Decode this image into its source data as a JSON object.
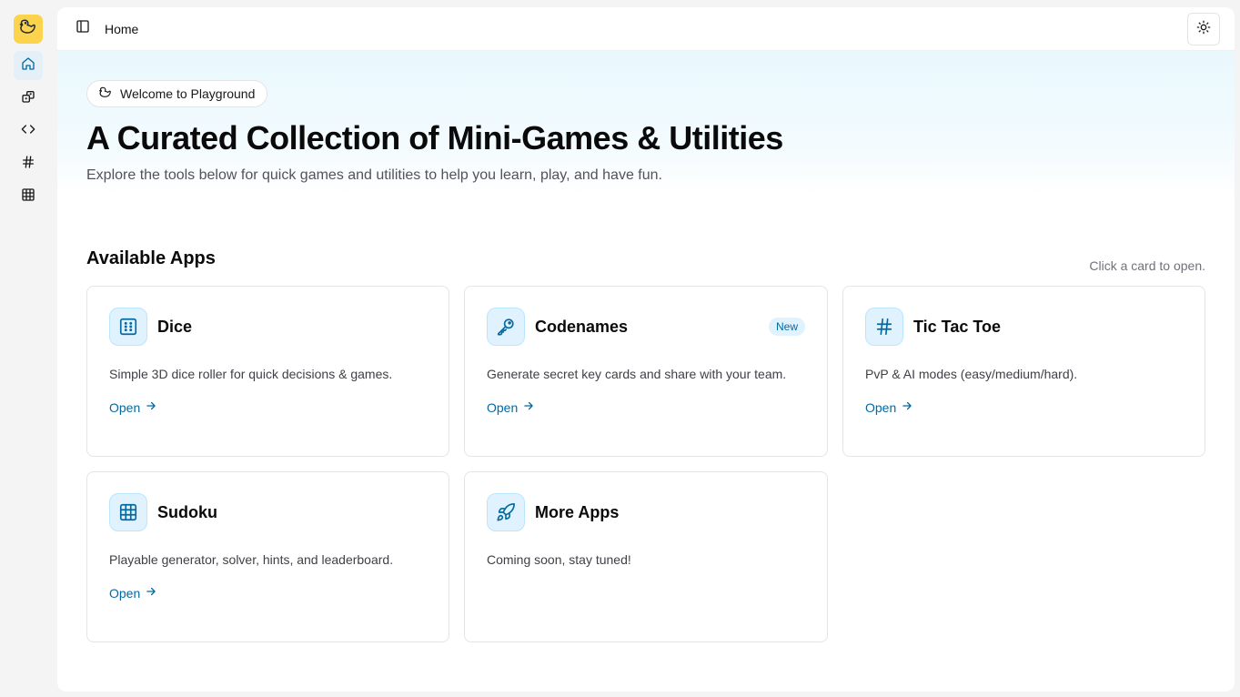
{
  "sidebar": {
    "logo_icon": "duck-icon",
    "items": [
      {
        "name": "home",
        "icon": "home-icon",
        "active": true
      },
      {
        "name": "dice",
        "icon": "dice-icon",
        "active": false
      },
      {
        "name": "code",
        "icon": "code-icon",
        "active": false
      },
      {
        "name": "hash",
        "icon": "hash-icon",
        "active": false
      },
      {
        "name": "grid",
        "icon": "grid-icon",
        "active": false
      }
    ]
  },
  "topbar": {
    "title": "Home",
    "toggle_icon": "sidebar-toggle-icon",
    "theme_icon": "sun-icon"
  },
  "hero": {
    "pill_label": "Welcome to Playground",
    "title": "A Curated Collection of Mini-Games & Utilities",
    "subtitle": "Explore the tools below for quick games and utilities to help you learn, play, and have fun."
  },
  "apps_section": {
    "title": "Available Apps",
    "hint": "Click a card to open.",
    "cards": [
      {
        "title": "Dice",
        "icon": "dice-icon",
        "description": "Simple 3D dice roller for quick decisions & games.",
        "link": "Open",
        "badge": ""
      },
      {
        "title": "Codenames",
        "icon": "key-icon",
        "description": "Generate secret key cards and share with your team.",
        "link": "Open",
        "badge": "New"
      },
      {
        "title": "Tic Tac Toe",
        "icon": "hash-icon",
        "description": "PvP & AI modes (easy/medium/hard).",
        "link": "Open",
        "badge": ""
      },
      {
        "title": "Sudoku",
        "icon": "grid-icon",
        "description": "Playable generator, solver, hints, and leaderboard.",
        "link": "Open",
        "badge": ""
      },
      {
        "title": "More Apps",
        "icon": "rocket-icon",
        "description": "Coming soon, stay tuned!",
        "link": "",
        "badge": ""
      }
    ]
  },
  "colors": {
    "accent": "#0369a1",
    "logo_bg": "#fcd34d",
    "icon_bg": "#e0f2fe"
  }
}
